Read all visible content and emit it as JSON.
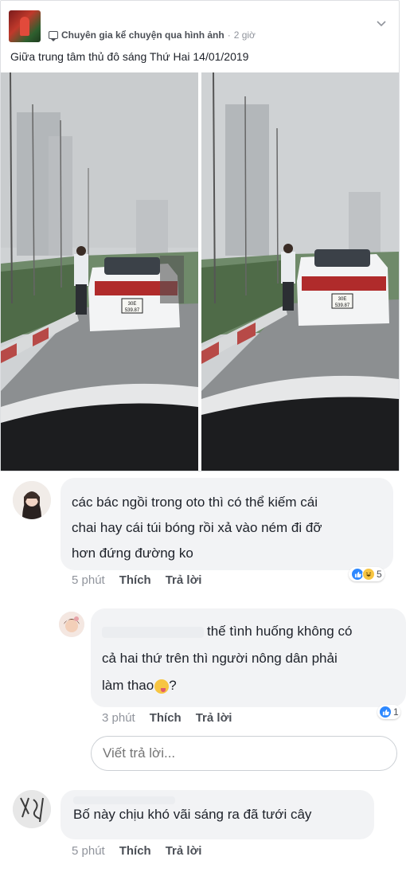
{
  "post": {
    "author": "Chuyên gia kể chuyện qua hình ảnh",
    "separator": "·",
    "time": "2 giờ",
    "text": "Giữa trung tâm thủ đô sáng Thứ Hai 14/01/2019",
    "photos": [
      {
        "plate_top": "30E",
        "plate_bottom": "539.87"
      },
      {
        "plate_top": "30E",
        "plate_bottom": "539.87"
      }
    ]
  },
  "comments": [
    {
      "text": "các bác ngồi trong oto thì có thể kiếm cái chai hay cái túi bóng rồi xả vào ném đi đỡ hơn đứng đường ko",
      "line1": "các bác ngồi trong oto thì có thể kiếm cái",
      "line2": "chai hay cái túi bóng rồi xả vào ném đi đỡ",
      "line3": "hơn đứng đường ko",
      "time": "5 phút",
      "like": "Thích",
      "reply": "Trả lời",
      "reaction_count": "5"
    },
    {
      "line1": "thế tình huống không có",
      "line2": "cả hai thứ trên thì người nông dân phải",
      "line3": "làm thao",
      "line3_end": "?",
      "time": "3 phút",
      "like": "Thích",
      "reply": "Trả lời",
      "reaction_count": "1"
    },
    {
      "text": "Bố này chịu khó vãi sáng ra đã tưới cây",
      "time": "5 phút",
      "like": "Thích",
      "reply": "Trả lời"
    }
  ],
  "reply_input": {
    "placeholder": "Viết trả lời..."
  },
  "colors": {
    "accent": "#2d88ff",
    "bubble": "#f2f3f5",
    "muted": "#90949c"
  }
}
